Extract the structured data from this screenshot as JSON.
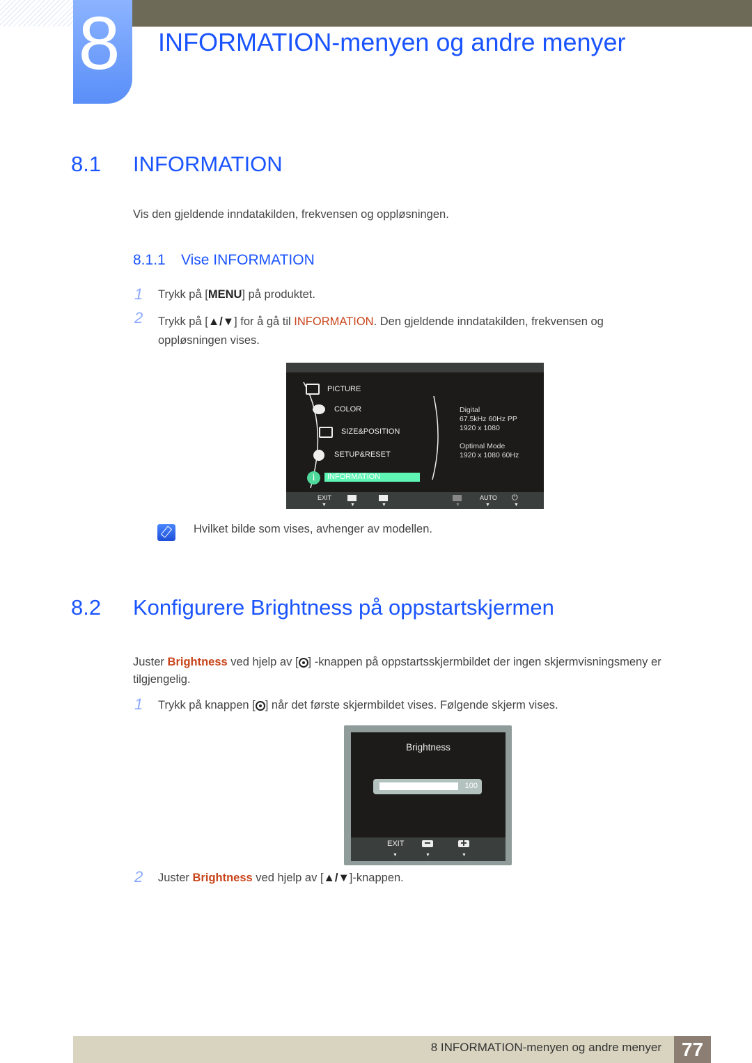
{
  "header": {
    "chapter_number": "8",
    "chapter_title": "INFORMATION-menyen og andre menyer"
  },
  "section_8_1": {
    "number": "8.1",
    "title": "INFORMATION",
    "intro": "Vis den gjeldende inndatakilden, frekvensen og oppløsningen.",
    "subsection": {
      "number": "8.1.1",
      "title": "Vise INFORMATION"
    },
    "steps": [
      {
        "n": "1",
        "pre": "Trykk på [",
        "key": "MENU",
        "post": "] på produktet."
      },
      {
        "n": "2",
        "pre": "Trykk på [",
        "key": "▲/▼",
        "mid": "] for å gå til ",
        "highlight": "INFORMATION",
        "post": ". Den gjeldende inndatakilden, frekvensen og",
        "line2": "oppløsningen vises."
      }
    ],
    "osd": {
      "menu_items": [
        "PICTURE",
        "COLOR",
        "SIZE&POSITION",
        "SETUP&RESET",
        "INFORMATION"
      ],
      "selected": "INFORMATION",
      "info_lines": [
        "Digital",
        "67.5kHz 60Hz PP",
        "1920 x 1080"
      ],
      "optimal_lines": [
        "Optimal Mode",
        "1920 x 1080 60Hz"
      ],
      "buttons": [
        "EXIT",
        "▼",
        "▲",
        "▶",
        "AUTO",
        "⏻"
      ]
    },
    "note": "Hvilket bilde som vises, avhenger av modellen."
  },
  "section_8_2": {
    "number": "8.2",
    "title": "Konfigurere Brightness på oppstartskjermen",
    "intro_pre": "Juster ",
    "intro_highlight": "Brightness",
    "intro_mid": " ved hjelp av [",
    "intro_post": "] -knappen på oppstartsskjermbildet der ingen skjermvisningsmeny er",
    "intro_line2": "tilgjengelig.",
    "step1": {
      "n": "1",
      "pre": "Trykk på knappen [",
      "post": "] når det første skjermbildet vises. Følgende skjerm vises."
    },
    "osd": {
      "title": "Brightness",
      "value": "100",
      "value_fraction": 1.0,
      "buttons": [
        "EXIT",
        "−",
        "+"
      ]
    },
    "step2": {
      "n": "2",
      "pre": "Juster ",
      "highlight": "Brightness",
      "mid": " ved hjelp av [",
      "key": "▲/▼",
      "post": "]-knappen."
    }
  },
  "footer": {
    "text": "8 INFORMATION-menyen og andre menyer",
    "page": "77"
  }
}
